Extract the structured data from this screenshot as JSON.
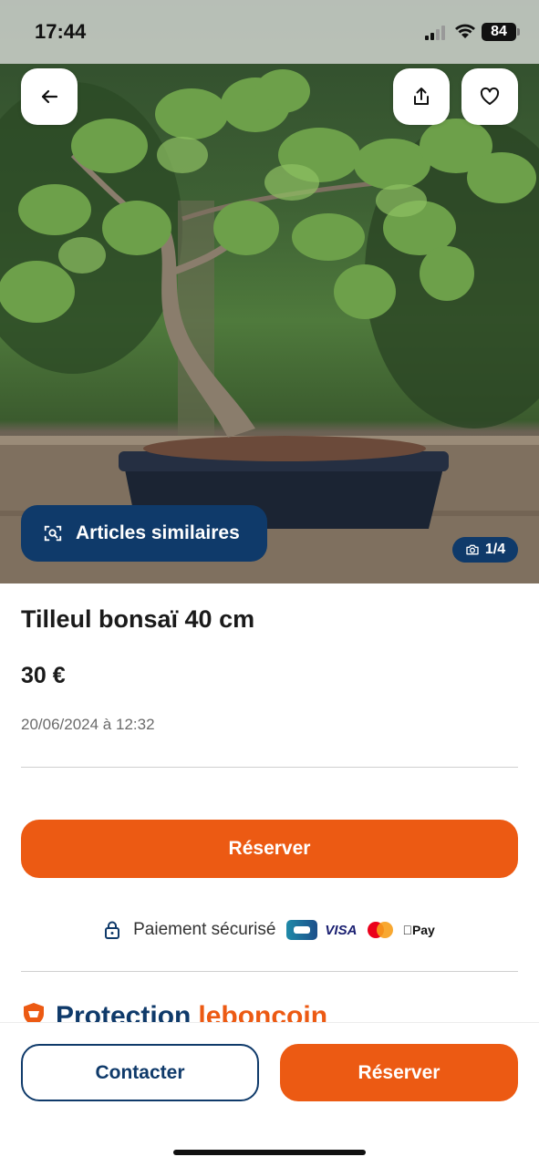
{
  "status_bar": {
    "time": "17:44",
    "battery": "84"
  },
  "listing": {
    "title": "Tilleul bonsaï 40 cm",
    "price": "30 €",
    "date": "20/06/2024 à 12:32",
    "photo_counter": "1/4",
    "similar_label": "Articles similaires"
  },
  "actions": {
    "reserve_label": "Réserver",
    "contact_label": "Contacter"
  },
  "payment": {
    "label": "Paiement sécurisé",
    "visa": "VISA",
    "apple_pay": "Pay",
    "methods": [
      "CB",
      "Visa",
      "Mastercard",
      "Apple Pay"
    ]
  },
  "protection": {
    "word1": "Protection",
    "word2": "leboncoin"
  },
  "icons": {
    "back": "arrow-left-icon",
    "share": "share-icon",
    "favorite": "heart-icon",
    "similar": "visual-search-icon",
    "camera": "camera-icon",
    "lock": "lock-icon"
  },
  "colors": {
    "brand_orange": "#ec5a13",
    "brand_navy": "#0f3a6a"
  }
}
